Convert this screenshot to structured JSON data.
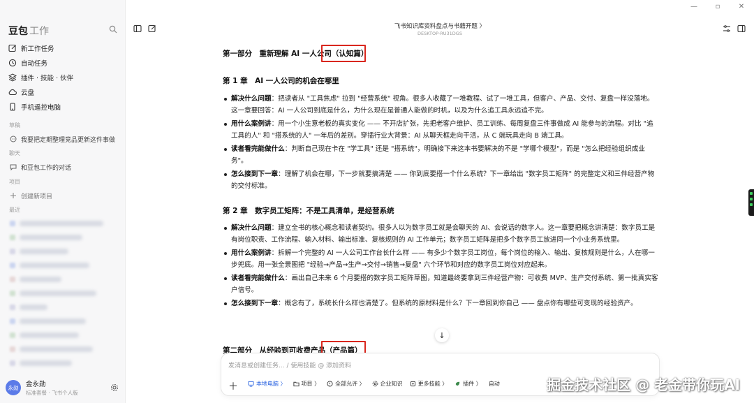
{
  "window": {
    "controls": [
      "—",
      "▫",
      "✕"
    ]
  },
  "sidebar": {
    "brand": "豆包",
    "brand_sub": "工作",
    "nav": [
      {
        "label": "新工作任务",
        "icon": "edit-icon"
      },
      {
        "label": "自动任务",
        "icon": "clock-icon"
      },
      {
        "label": "插件 · 技能 · 伙伴",
        "icon": "plugin-icon"
      },
      {
        "label": "云盘",
        "icon": "cloud-icon"
      },
      {
        "label": "手机遥控电脑",
        "icon": "phone-icon"
      }
    ],
    "section_drafts": "草稿",
    "draft_item": "我要把定期整理竞品更新这件事做",
    "section_chats": "聊天",
    "chat_item": "和豆包工作的对话",
    "section_projects": "项目",
    "create_project": "创建新项目",
    "section_recent": "最近",
    "user_name": "金永勋",
    "user_avatar": "永勋",
    "user_plan": "标准套餐 · 飞书个人版"
  },
  "topbar": {
    "doc_title": "飞书知识库资料盘点与书籍开题 〉",
    "host": "DESKTOP-RU31DGS"
  },
  "doc": {
    "part1": "第一部分　重新理解 AI 一人公司（认知篇）",
    "ch1": "第 1 章　AI 一人公司的机会在哪里",
    "ch1_bullets": [
      {
        "k": "解决什么问题",
        "v": "：把读者从 \"工具焦虑\" 拉到 \"经营系统\" 视角。很多人收藏了一堆教程、试了一堆工具，但客户、产品、交付、复盘一样没落地。这一章要回答：AI 一人公司到底是什么，为什么现在是普通人能做的时机，以及为什么追工具永远追不完。"
      },
      {
        "k": "用什么案例讲",
        "v": "：用一个小生意老板的真实变化 —— 不开店扩张，先把老客户维护、员工训练、每周复盘三件事做成 AI 能参与的流程。对比 \"追工具的人\" 和 \"搭系统的人\" 一年后的差别。穿插行业大背景：AI 从聊天框走向干活，从 C 端玩具走向 B 端工具。"
      },
      {
        "k": "读者看完能做什么",
        "v": "：判断自己现在卡在 \"学工具\" 还是 \"搭系统\"，明确接下来这本书要解决的不是 \"学哪个模型\"，而是 \"怎么把经验组织成业务\"。"
      },
      {
        "k": "怎么接到下一章",
        "v": "：理解了机会在哪，下一步就要搞清楚 —— 你到底要搭一个什么系统？下一章给出 \"数字员工矩阵\" 的完整定义和三件经营产物的交付标准。"
      }
    ],
    "ch2": "第 2 章　数字员工矩阵：不是工具清单，是经营系统",
    "ch2_bullets": [
      {
        "k": "解决什么问题",
        "v": "：建立全书的核心概念和读者契约。很多人以为数字员工就是会聊天的 AI、会说话的数字人。这一章要把概念讲清楚：数字员工是有岗位职责、工作流程、输入材料、输出标准、复核规则的 AI 工作单元；数字员工矩阵是把多个数字员工放进同一个小业务系统里。"
      },
      {
        "k": "用什么案例讲",
        "v": "：拆解一个完整的 AI 一人公司工作台长什么样 —— 有多少个数字员工岗位，每个岗位的输入、输出、复核规则是什么，人在哪一步兜底。用一张全景图把 \"经验→产品→生产→交付→销售→复盘\" 六个环节和对应的数字员工岗位对应起来。"
      },
      {
        "k": "读者看完能做什么",
        "v": "：画出自己未来 6 个月要搭的数字员工矩阵草图，知道最终要拿到三件经营产物：可收费 MVP、生产交付系统、第一批真实客户信号。"
      },
      {
        "k": "怎么接到下一章",
        "v": "：概念有了，系统长什么样也清楚了。但系统的原材料是什么？下一章回到你自己 —— 盘点你有哪些可变现的经验资产。"
      }
    ],
    "part2": "第二部分　从经验到可收费产品（产品篇）"
  },
  "composer": {
    "placeholder": "发消息或创建任务... / 使用技能 @ 添加资料",
    "plus": "＋",
    "chips": [
      "本地电脑 〉",
      "项目 〉",
      "全部允许 〉",
      "企业知识",
      "更多技能 〉",
      "插件 〉",
      "自动"
    ]
  },
  "watermark": "掘金技术社区 @ 老金带你玩AI",
  "scroll_icon": "↓"
}
